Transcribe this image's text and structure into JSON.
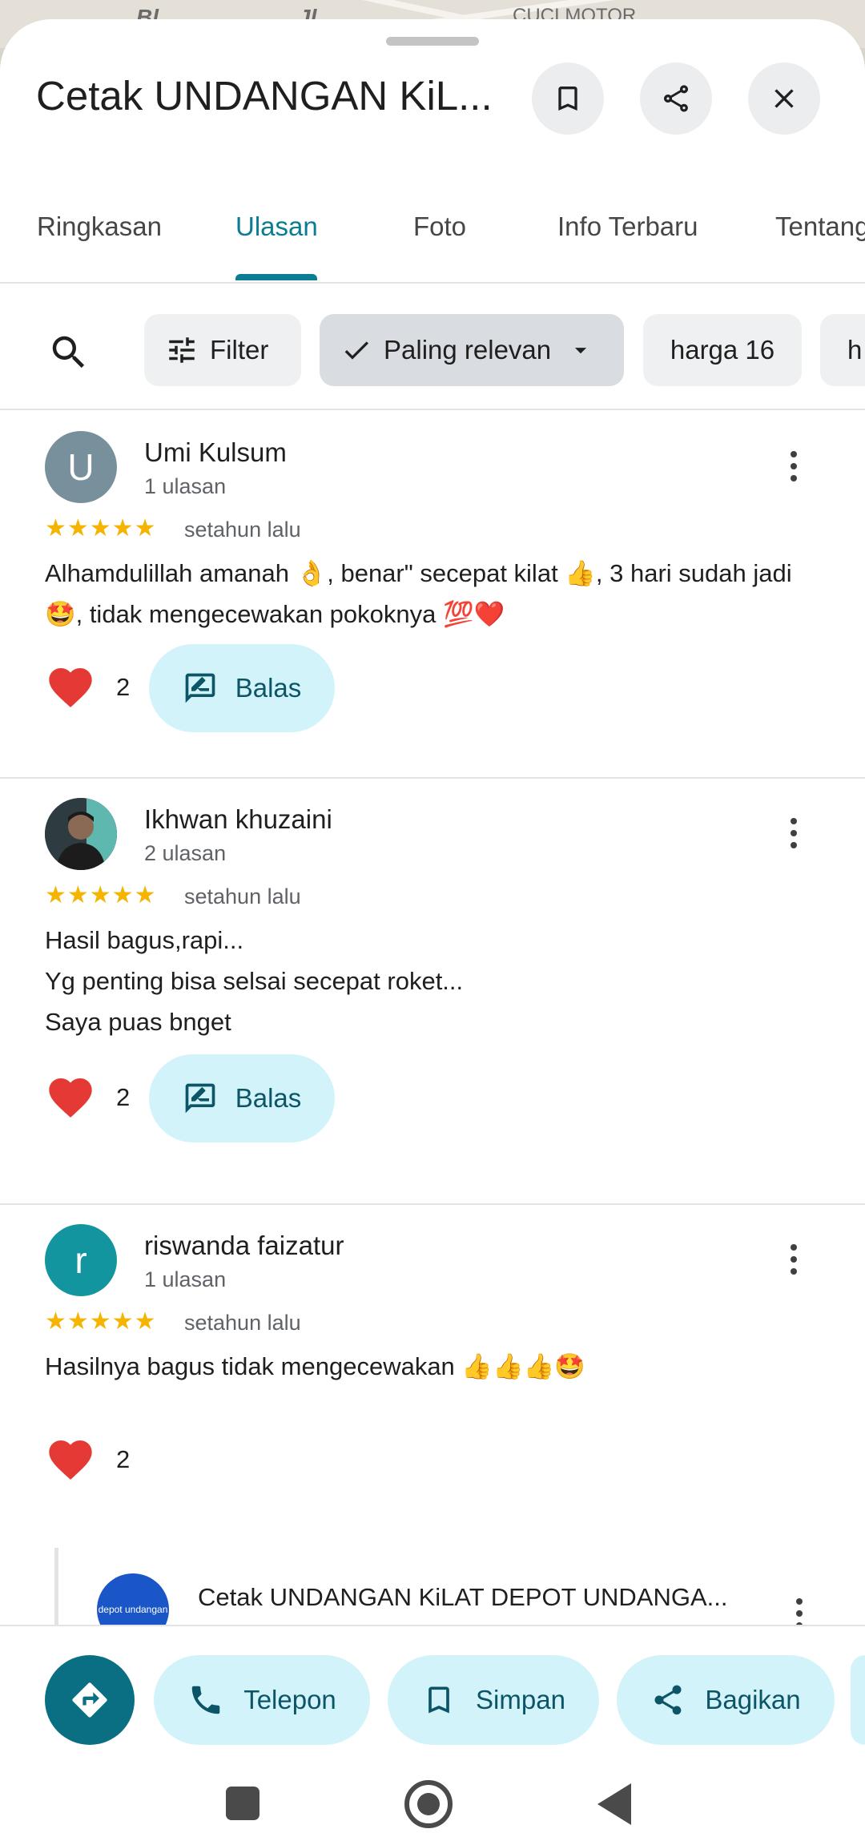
{
  "map": {
    "labels": [
      "Bl",
      "Jl",
      "CUCI MOTOR"
    ]
  },
  "header": {
    "title": "Cetak UNDANGAN KiL...",
    "buttons": [
      "bookmark-icon",
      "share-icon",
      "close-icon"
    ]
  },
  "tabs": [
    {
      "label": "Ringkasan",
      "active": false
    },
    {
      "label": "Ulasan",
      "active": true
    },
    {
      "label": "Foto",
      "active": false
    },
    {
      "label": "Info Terbaru",
      "active": false
    },
    {
      "label": "Tentang",
      "active": false
    }
  ],
  "filters": {
    "search_icon": "search-icon",
    "filter_label": "Filter",
    "sort_label": "Paling relevan",
    "chips": [
      "harga 16",
      "h"
    ]
  },
  "reviews": [
    {
      "avatar_letter": "U",
      "avatar_color": "#78909c",
      "name": "Umi Kulsum",
      "count": "1 ulasan",
      "stars": "★★★★★",
      "rating": 5,
      "date": "setahun lalu",
      "text": "Alhamdulillah amanah 👌, benar\" secepat kilat 👍, 3 hari sudah jadi 🤩, tidak mengecewakan pokoknya 💯❤️",
      "likes": "2",
      "reply_label": "Balas"
    },
    {
      "avatar_letter": "",
      "avatar_color": "#3b4a52",
      "name": "Ikhwan khuzaini",
      "count": "2 ulasan",
      "stars": "★★★★★",
      "rating": 5,
      "date": "setahun lalu",
      "text_lines": [
        "Hasil bagus,rapi...",
        "Yg penting bisa selsai secepat roket...",
        "Saya puas bnget"
      ],
      "likes": "2",
      "reply_label": "Balas"
    },
    {
      "avatar_letter": "r",
      "avatar_color": "#12959e",
      "name": "riswanda faizatur",
      "count": "1 ulasan",
      "stars": "★★★★★",
      "rating": 5,
      "date": "setahun lalu",
      "text": "Hasilnya bagus tidak mengecewakan 👍👍👍🤩",
      "likes": "2"
    }
  ],
  "owner_reply": {
    "logo_text": "depot undangan",
    "name": "Cetak UNDANGAN KiLAT DEPOT UNDANGA..."
  },
  "actions": {
    "directions_icon": "directions-icon",
    "buttons": [
      {
        "label": "Telepon",
        "icon": "phone-icon"
      },
      {
        "label": "Simpan",
        "icon": "bookmark-icon"
      },
      {
        "label": "Bagikan",
        "icon": "share-icon"
      }
    ]
  },
  "colors": {
    "accent": "#0b7c94",
    "chip_bg": "#eef0f1",
    "reply_bg": "#d3f3fb",
    "star": "#f4b400",
    "heart": "#e53935"
  }
}
